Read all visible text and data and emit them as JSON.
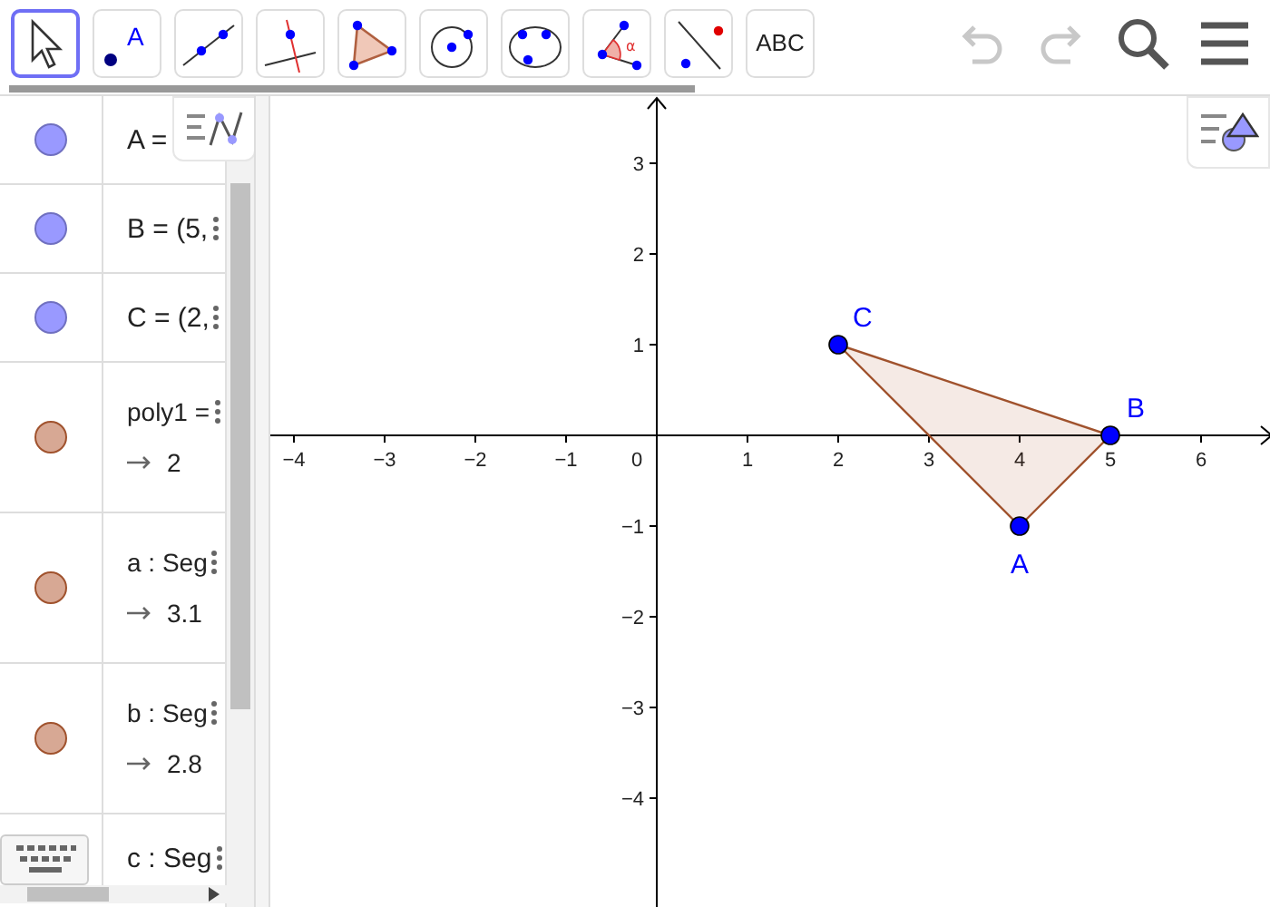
{
  "toolbar": {
    "tools": [
      {
        "kind": "move",
        "selected": true
      },
      {
        "kind": "point",
        "label": "A",
        "selected": false
      },
      {
        "kind": "line",
        "selected": false
      },
      {
        "kind": "perpendicular",
        "selected": false
      },
      {
        "kind": "polygon",
        "selected": false
      },
      {
        "kind": "circle",
        "selected": false
      },
      {
        "kind": "conic",
        "selected": false
      },
      {
        "kind": "angle",
        "label": "α",
        "selected": false
      },
      {
        "kind": "reflect",
        "selected": false
      },
      {
        "kind": "text",
        "label": "ABC",
        "selected": false
      }
    ]
  },
  "algebra": {
    "rows": [
      {
        "label": "A =",
        "color": "#9999ff"
      },
      {
        "label": "B = (5,",
        "color": "#9999ff"
      },
      {
        "label": "C = (2,",
        "color": "#9999ff"
      },
      {
        "label": "poly1 =",
        "value": "2",
        "color": "#d7a894"
      },
      {
        "label": "a : Seg",
        "value": "3.1",
        "color": "#d7a894"
      },
      {
        "label": "b : Seg",
        "value": "2.8",
        "color": "#d7a894"
      },
      {
        "label": "c : Seg"
      }
    ]
  },
  "graphics": {
    "point_labels": [
      "A",
      "B",
      "C"
    ],
    "origin_label": "0",
    "chart_data": {
      "type": "scatter",
      "x": [
        4,
        5,
        2
      ],
      "series": [
        {
          "color": "#0000ff",
          "values": [
            -1,
            0,
            1
          ]
        }
      ],
      "xlim": [
        -4.26,
        6.8
      ],
      "ylim": [
        -5.22,
        3.74
      ],
      "xticks": [
        {
          "value": -4,
          "label": "−4"
        },
        {
          "value": -3,
          "label": "−3"
        },
        {
          "value": -2,
          "label": "−2"
        },
        {
          "value": -1,
          "label": "−1"
        },
        1,
        2,
        3,
        4,
        5,
        6
      ],
      "yticks": [
        {
          "value": -4,
          "label": "−4"
        },
        {
          "value": -3,
          "label": "−3"
        },
        {
          "value": -2,
          "label": "−2"
        },
        {
          "value": -1,
          "label": "−1"
        },
        1,
        2,
        3
      ]
    }
  }
}
